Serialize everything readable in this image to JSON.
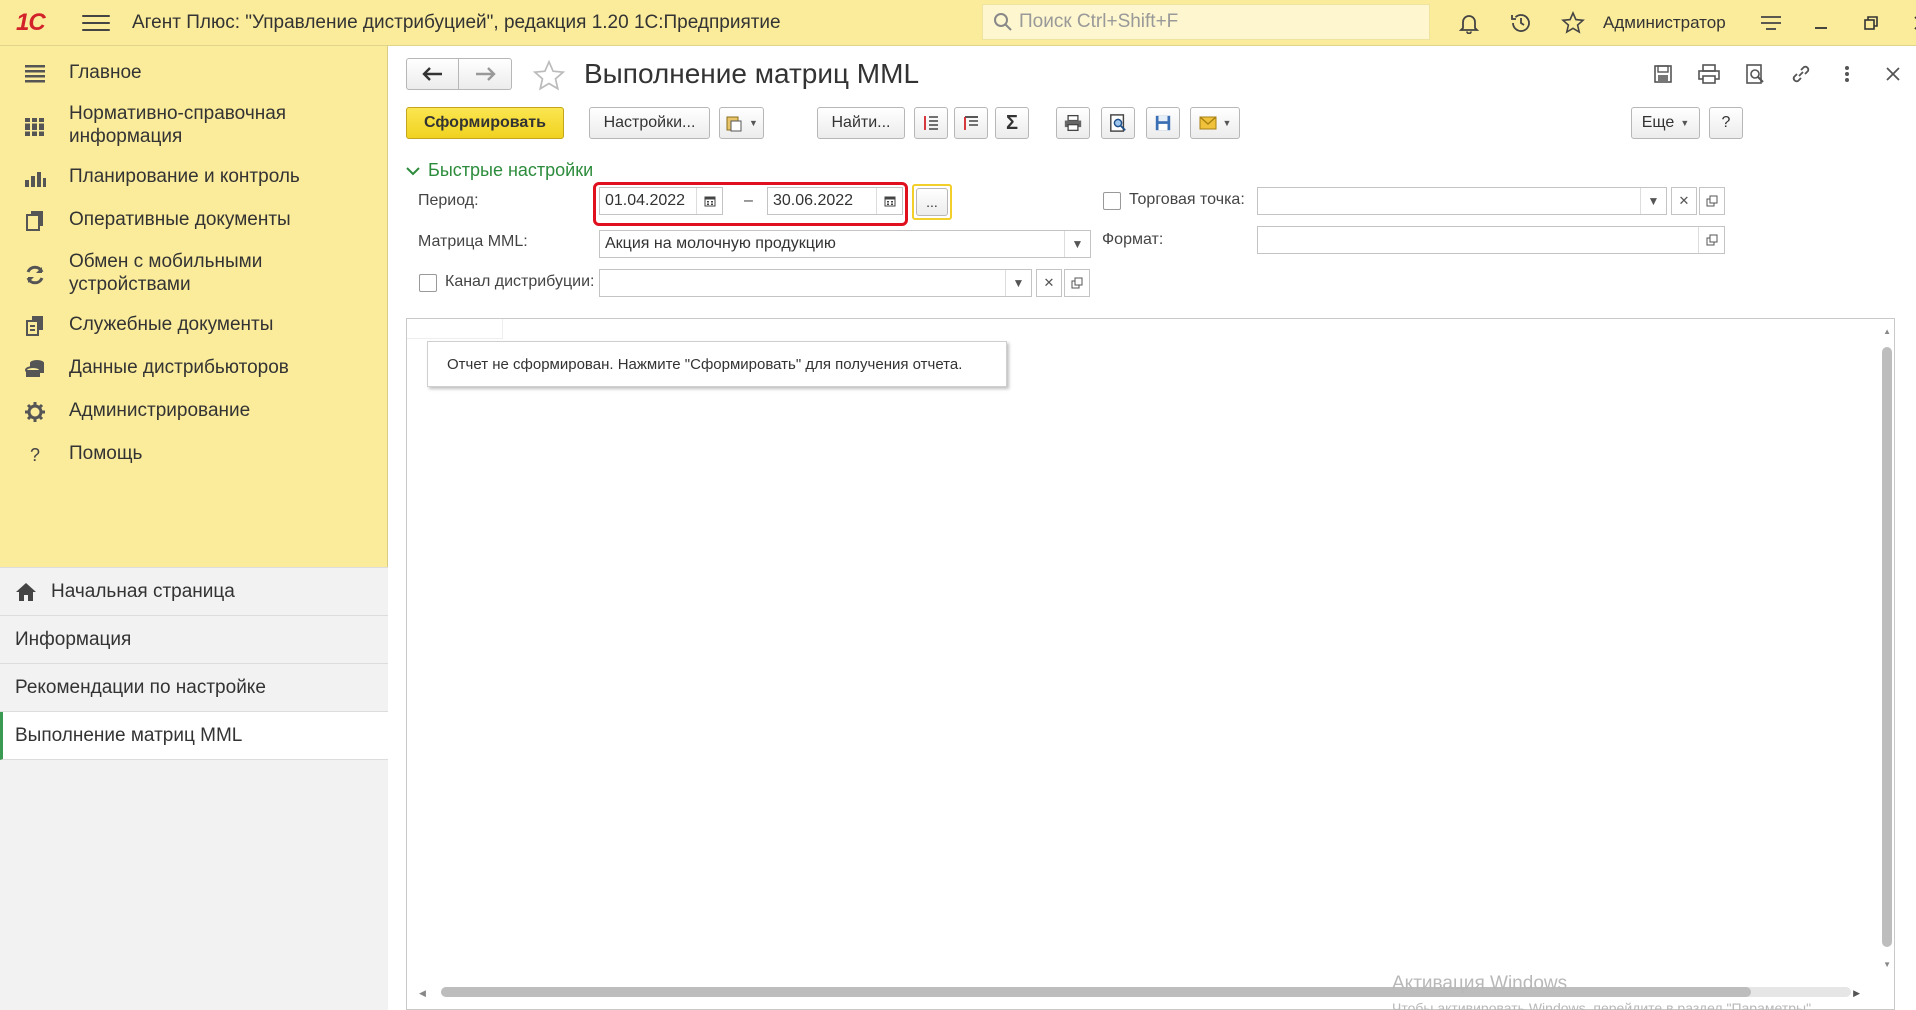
{
  "app": {
    "logo": "1С",
    "title": "Агент Плюс: \"Управление дистрибуцией\", редакция 1.20 1С:Предприятие",
    "search_placeholder": "Поиск Ctrl+Shift+F",
    "user": "Администратор"
  },
  "sidebar": {
    "sections": [
      {
        "label": "Главное",
        "icon": "list-icon"
      },
      {
        "label": "Нормативно-справочная информация",
        "icon": "book-icon"
      },
      {
        "label": "Планирование и контроль",
        "icon": "chart-icon"
      },
      {
        "label": "Оперативные документы",
        "icon": "documents-icon"
      },
      {
        "label": "Обмен с мобильными устройствами",
        "icon": "sync-icon"
      },
      {
        "label": "Служебные документы",
        "icon": "service-docs-icon"
      },
      {
        "label": "Данные дистрибьюторов",
        "icon": "database-icon"
      },
      {
        "label": "Администрирование",
        "icon": "gear-icon"
      },
      {
        "label": "Помощь",
        "icon": "help-icon"
      }
    ],
    "links": [
      {
        "label": "Начальная страница",
        "icon": "home-icon"
      },
      {
        "label": "Информация"
      },
      {
        "label": "Рекомендации по настройке"
      },
      {
        "label": "Выполнение матриц MML",
        "active": true
      }
    ]
  },
  "page": {
    "title": "Выполнение матриц MML",
    "toolbar": {
      "generate": "Сформировать",
      "settings": "Настройки...",
      "find": "Найти...",
      "more": "Еще",
      "help": "?"
    },
    "quick_settings": "Быстрые настройки",
    "form": {
      "period_label": "Период:",
      "period_from": "01.04.2022",
      "period_sep": "–",
      "period_to": "30.06.2022",
      "dots": "...",
      "matrix_label": "Матрица MML:",
      "matrix_value": "Акция на молочную продукцию",
      "channel_label": "Канал дистрибуции:",
      "channel_value": "",
      "outlet_label": "Торговая точка:",
      "outlet_value": "",
      "format_label": "Формат:",
      "format_value": ""
    },
    "report_notice": "Отчет не сформирован. Нажмите \"Сформировать\" для получения отчета.",
    "watermark_title": "Активация Windows",
    "watermark_text": "Чтобы активировать Windows, перейдите в раздел \"Параметры\"."
  },
  "colors": {
    "topbar": "#fbec9c",
    "accent_green": "#2c8c3c",
    "primary_button": "#f0d21f",
    "highlight_red": "#e0101f"
  }
}
